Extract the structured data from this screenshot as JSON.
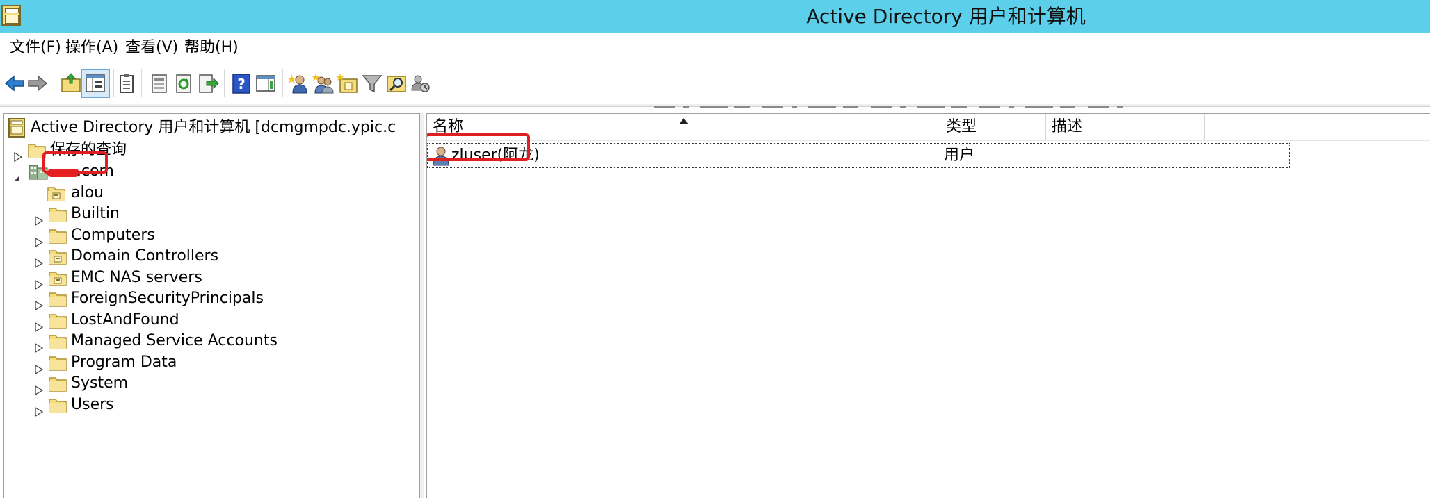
{
  "window": {
    "title": "Active Directory 用户和计算机"
  },
  "menu": [
    "文件(F)",
    "操作(A)",
    "查看(V)",
    "帮助(H)"
  ],
  "toolbar": {
    "buttons": [
      "back-icon",
      "forward-icon",
      "up-folder-icon",
      "show-hide-console-tree-icon",
      "clipboard-icon",
      "properties-icon",
      "refresh-icon",
      "export-list-icon",
      "help-icon",
      "action-pane-icon",
      "new-user-icon",
      "new-group-icon",
      "new-ou-icon",
      "filter-icon",
      "find-icon",
      "delegate-icon"
    ]
  },
  "tree": {
    "root": "Active Directory 用户和计算机 [dcmgmpdc.ypic.c",
    "items": [
      {
        "label": "保存的查询",
        "icon": "folder-icon",
        "expandable": true
      },
      {
        "label": ".com",
        "icon": "domain-icon",
        "expanded": true
      },
      {
        "label": "alou",
        "icon": "ou-icon",
        "expandable": false
      },
      {
        "label": "Builtin",
        "icon": "folder-icon",
        "expandable": true
      },
      {
        "label": "Computers",
        "icon": "folder-icon",
        "expandable": true
      },
      {
        "label": "Domain Controllers",
        "icon": "ou-icon",
        "expandable": true
      },
      {
        "label": "EMC NAS servers",
        "icon": "ou-icon",
        "expandable": true
      },
      {
        "label": "ForeignSecurityPrincipals",
        "icon": "folder-icon",
        "expandable": true
      },
      {
        "label": "LostAndFound",
        "icon": "folder-icon",
        "expandable": true
      },
      {
        "label": "Managed Service Accounts",
        "icon": "folder-icon",
        "expandable": true
      },
      {
        "label": "Program Data",
        "icon": "folder-icon",
        "expandable": true
      },
      {
        "label": "System",
        "icon": "folder-icon",
        "expandable": true
      },
      {
        "label": "Users",
        "icon": "folder-icon",
        "expandable": true
      }
    ]
  },
  "list": {
    "columns": [
      "名称",
      "类型",
      "描述"
    ],
    "rows": [
      {
        "name": "zluser(阿龙)",
        "type": "用户",
        "description": ""
      }
    ]
  },
  "colors": {
    "titlebar": "#5ccfea",
    "highlight": "#e02020",
    "folder": "#f3dd7c"
  }
}
